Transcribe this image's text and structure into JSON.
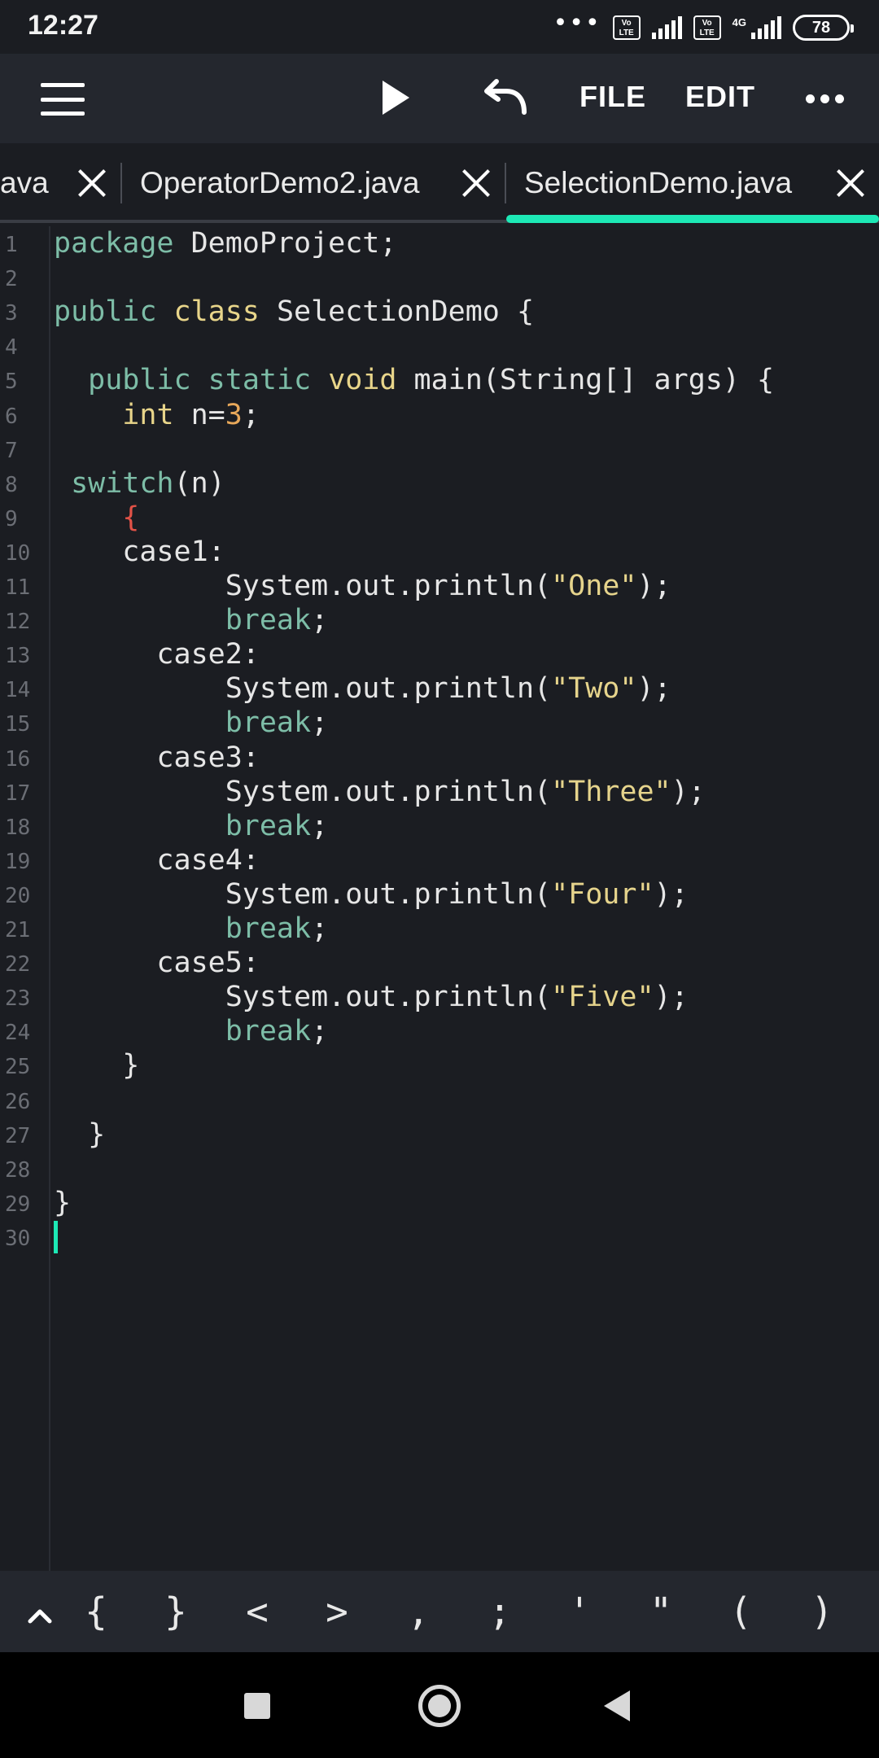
{
  "status_bar": {
    "time": "12:27",
    "dots": "•••",
    "volte_1": "Vo LTE",
    "volte_2": "Vo LTE",
    "network": "4G",
    "battery": "78"
  },
  "toolbar": {
    "menu_icon": "hamburger-menu-icon",
    "run_icon": "play-icon",
    "undo_icon": "undo-icon",
    "file_label": "FILE",
    "edit_label": "EDIT",
    "more_icon": "more-dots-icon"
  },
  "tabs": [
    {
      "label": "ava",
      "active": false
    },
    {
      "label": "OperatorDemo2.java",
      "active": false
    },
    {
      "label": "SelectionDemo.java",
      "active": true
    }
  ],
  "colors": {
    "accent": "#1de9b6",
    "keyword": "#7dbda7",
    "type": "#e8d58a",
    "number": "#e8a85a",
    "string": "#e6d48c",
    "error_brace": "#e25247",
    "background": "#1b1d22",
    "toolbar_bg": "#24272e"
  },
  "editor": {
    "line_numbers": [
      "1",
      "2",
      "3",
      "4",
      "5",
      "6",
      "7",
      "8",
      "9",
      "10",
      "11",
      "12",
      "13",
      "14",
      "15",
      "16",
      "17",
      "18",
      "19",
      "20",
      "21",
      "22",
      "23",
      "24",
      "25",
      "26",
      "27",
      "28",
      "29",
      "30"
    ],
    "lines": [
      [
        {
          "t": "package",
          "c": "kw"
        },
        {
          "t": " DemoProject;",
          "c": "plain"
        }
      ],
      [],
      [
        {
          "t": "public",
          "c": "kw"
        },
        {
          "t": " ",
          "c": "plain"
        },
        {
          "t": "class",
          "c": "type"
        },
        {
          "t": " SelectionDemo {",
          "c": "plain"
        }
      ],
      [],
      [
        {
          "t": "  ",
          "c": "plain"
        },
        {
          "t": "public",
          "c": "kw"
        },
        {
          "t": " ",
          "c": "plain"
        },
        {
          "t": "static",
          "c": "kw"
        },
        {
          "t": " ",
          "c": "plain"
        },
        {
          "t": "void",
          "c": "type"
        },
        {
          "t": " main(String[] args) {",
          "c": "plain"
        }
      ],
      [
        {
          "t": "    ",
          "c": "plain"
        },
        {
          "t": "int",
          "c": "type"
        },
        {
          "t": " n=",
          "c": "plain"
        },
        {
          "t": "3",
          "c": "num"
        },
        {
          "t": ";",
          "c": "plain"
        }
      ],
      [],
      [
        {
          "t": " ",
          "c": "plain"
        },
        {
          "t": "switch",
          "c": "kw"
        },
        {
          "t": "(n)",
          "c": "plain"
        }
      ],
      [
        {
          "t": "    ",
          "c": "plain"
        },
        {
          "t": "{",
          "c": "brace-red"
        }
      ],
      [
        {
          "t": "    case1:",
          "c": "plain"
        }
      ],
      [
        {
          "t": "          System.out.println(",
          "c": "plain"
        },
        {
          "t": "\"One\"",
          "c": "str"
        },
        {
          "t": ");",
          "c": "plain"
        }
      ],
      [
        {
          "t": "          ",
          "c": "plain"
        },
        {
          "t": "break",
          "c": "kw"
        },
        {
          "t": ";",
          "c": "plain"
        }
      ],
      [
        {
          "t": "      case2:",
          "c": "plain"
        }
      ],
      [
        {
          "t": "          System.out.println(",
          "c": "plain"
        },
        {
          "t": "\"Two\"",
          "c": "str"
        },
        {
          "t": ");",
          "c": "plain"
        }
      ],
      [
        {
          "t": "          ",
          "c": "plain"
        },
        {
          "t": "break",
          "c": "kw"
        },
        {
          "t": ";",
          "c": "plain"
        }
      ],
      [
        {
          "t": "      case3:",
          "c": "plain"
        }
      ],
      [
        {
          "t": "          System.out.println(",
          "c": "plain"
        },
        {
          "t": "\"Three\"",
          "c": "str"
        },
        {
          "t": ");",
          "c": "plain"
        }
      ],
      [
        {
          "t": "          ",
          "c": "plain"
        },
        {
          "t": "break",
          "c": "kw"
        },
        {
          "t": ";",
          "c": "plain"
        }
      ],
      [
        {
          "t": "      case4:",
          "c": "plain"
        }
      ],
      [
        {
          "t": "          System.out.println(",
          "c": "plain"
        },
        {
          "t": "\"Four\"",
          "c": "str"
        },
        {
          "t": ");",
          "c": "plain"
        }
      ],
      [
        {
          "t": "          ",
          "c": "plain"
        },
        {
          "t": "break",
          "c": "kw"
        },
        {
          "t": ";",
          "c": "plain"
        }
      ],
      [
        {
          "t": "      case5:",
          "c": "plain"
        }
      ],
      [
        {
          "t": "          System.out.println(",
          "c": "plain"
        },
        {
          "t": "\"Five\"",
          "c": "str"
        },
        {
          "t": ");",
          "c": "plain"
        }
      ],
      [
        {
          "t": "          ",
          "c": "plain"
        },
        {
          "t": "break",
          "c": "kw"
        },
        {
          "t": ";",
          "c": "plain"
        }
      ],
      [
        {
          "t": "    }",
          "c": "plain"
        }
      ],
      [],
      [
        {
          "t": "  }",
          "c": "plain"
        }
      ],
      [],
      [
        {
          "t": "}",
          "c": "plain"
        }
      ],
      []
    ]
  },
  "symbol_bar": {
    "caret_icon": "caret-up-icon",
    "keys": [
      "{",
      "}",
      "<",
      ">",
      ",",
      ";",
      "'",
      "\"",
      "(",
      ")"
    ]
  },
  "nav_bar": {
    "recents_icon": "square-icon",
    "home_icon": "home-circle-icon",
    "back_icon": "back-triangle-icon"
  }
}
